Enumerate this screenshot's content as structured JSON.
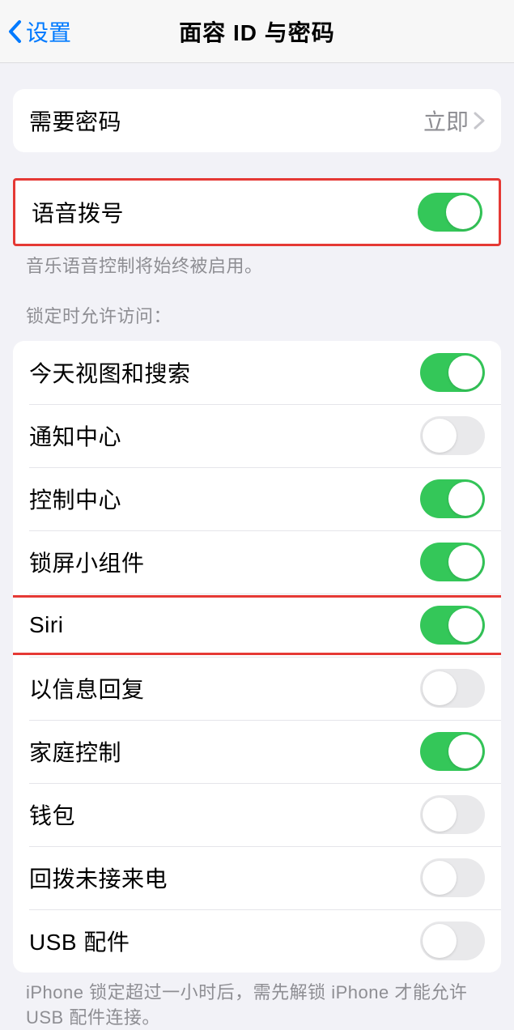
{
  "nav": {
    "back": "设置",
    "title": "面容 ID 与密码"
  },
  "require_passcode": {
    "label": "需要密码",
    "value": "立即"
  },
  "voice_dial": {
    "label": "语音拨号",
    "on": true,
    "footer": "音乐语音控制将始终被启用。"
  },
  "locked_access": {
    "header": "锁定时允许访问：",
    "items": [
      {
        "label": "今天视图和搜索",
        "on": true,
        "name": "today-view-search"
      },
      {
        "label": "通知中心",
        "on": false,
        "name": "notification-center"
      },
      {
        "label": "控制中心",
        "on": true,
        "name": "control-center"
      },
      {
        "label": "锁屏小组件",
        "on": true,
        "name": "lock-screen-widgets"
      },
      {
        "label": "Siri",
        "on": true,
        "name": "siri",
        "highlighted": true
      },
      {
        "label": "以信息回复",
        "on": false,
        "name": "reply-with-message"
      },
      {
        "label": "家庭控制",
        "on": true,
        "name": "home-control"
      },
      {
        "label": "钱包",
        "on": false,
        "name": "wallet"
      },
      {
        "label": "回拨未接来电",
        "on": false,
        "name": "return-missed-calls"
      },
      {
        "label": "USB 配件",
        "on": false,
        "name": "usb-accessories"
      }
    ],
    "footer": "iPhone 锁定超过一小时后，需先解锁 iPhone 才能允许 USB 配件连接。"
  }
}
